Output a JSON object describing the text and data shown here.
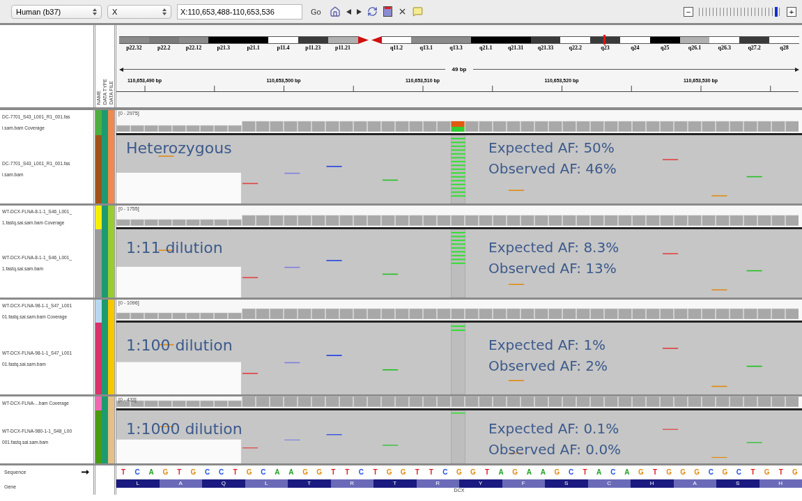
{
  "toolbar": {
    "genome": "Human (b37)",
    "chromosome": "X",
    "locus": "X:110,653,488-110,653,536",
    "go": "Go",
    "zoom": {
      "minus": "−",
      "plus": "+",
      "level": 0.96
    }
  },
  "attribute_headers": [
    "NAME",
    "DATA TYPE",
    "DATA FILE"
  ],
  "ideogram": {
    "bands": [
      {
        "label": "p22.32",
        "color": "#8a8a8a",
        "selected": false
      },
      {
        "label": "p22.2",
        "color": "#7a7a7a",
        "selected": false
      },
      {
        "label": "p22.12",
        "color": "#8a8a8a",
        "selected": false
      },
      {
        "label": "p21.3",
        "color": "#000000",
        "selected": false
      },
      {
        "label": "p21.1",
        "color": "#000000",
        "selected": false
      },
      {
        "label": "p11.4",
        "color": "#ffffff",
        "selected": false
      },
      {
        "label": "p11.23",
        "color": "#3a3a3a",
        "selected": false
      },
      {
        "label": "p11.21",
        "color": "#b0b0b0",
        "selected": false
      },
      {
        "label": "q11.2",
        "color": "#ffffff",
        "selected": false
      },
      {
        "label": "q13.1",
        "color": "#8a8a8a",
        "selected": false
      },
      {
        "label": "q13.3",
        "color": "#8a8a8a",
        "selected": false
      },
      {
        "label": "q21.1",
        "color": "#000000",
        "selected": false
      },
      {
        "label": "q21.31",
        "color": "#000000",
        "selected": false
      },
      {
        "label": "q21.33",
        "color": "#3a3a3a",
        "selected": false
      },
      {
        "label": "q22.2",
        "color": "#ffffff",
        "selected": false
      },
      {
        "label": "q23",
        "color": "#3a3a3a",
        "selected": true
      },
      {
        "label": "q24",
        "color": "#ffffff",
        "selected": false
      },
      {
        "label": "q25",
        "color": "#000000",
        "selected": false
      },
      {
        "label": "q26.1",
        "color": "#b0b0b0",
        "selected": false
      },
      {
        "label": "q26.3",
        "color": "#ffffff",
        "selected": false
      },
      {
        "label": "q27.2",
        "color": "#3a3a3a",
        "selected": false
      },
      {
        "label": "q28",
        "color": "#ffffff",
        "selected": false
      }
    ]
  },
  "ruler": {
    "span": "49 bp",
    "ticks": [
      "110,653,490 bp",
      "110,653,500 bp",
      "110,653,510 bp",
      "110,653,520 bp",
      "110,653,530 bp"
    ]
  },
  "tracks": [
    {
      "coverage_name": [
        "DC-7701_S43_L001_R1_001.fas",
        "i.sam.bam Coverage"
      ],
      "reads_name": [
        "DC-7701_S43_L001_R1_001.fas",
        "i.sam.bam"
      ],
      "range": "[0 - 2975]",
      "coverage_colors": [
        {
          "color": "#4caf3f"
        },
        {
          "color": "#1e9a70"
        },
        {
          "color": "#f08a50"
        }
      ],
      "reads_colors": [
        {
          "color": "#a0521a"
        },
        {
          "color": "#1e9a70"
        },
        {
          "color": "#f08a50"
        }
      ],
      "label": "Heterozygous",
      "expected": "Expected AF: 50%",
      "observed": "Observed AF: 46%"
    },
    {
      "coverage_name": [
        "WT-DCX-FLNA-8-1-1_S46_L001_",
        "1.fastq.sai.sam.bam Coverage"
      ],
      "reads_name": [
        "WT-DCX-FLNA-8-1-1_S46_L001_",
        "1.fastq.sai.sam.bam"
      ],
      "range": "[0 - 1755]",
      "coverage_colors": [
        {
          "color": "#f5f000"
        },
        {
          "color": "#1e9a70"
        },
        {
          "color": "#9acd32"
        }
      ],
      "reads_colors": [
        {
          "color": "#9a9a9a"
        },
        {
          "color": "#1e9a70"
        },
        {
          "color": "#9acd32"
        }
      ],
      "label": "1:11 dilution",
      "expected": "Expected AF: 8.3%",
      "observed": "Observed AF: 13%"
    },
    {
      "coverage_name": [
        "WT-DCX-FLNA-98-1-1_S47_L001",
        "01.fastq.sai.sam.bam Coverage"
      ],
      "reads_name": [
        "WT-DCX-FLNA-98-1-1_S47_L001",
        "01.fastq.sai.sam.bam"
      ],
      "range": "[0 - 1096]",
      "coverage_colors": [
        {
          "color": "#b8d8f0"
        },
        {
          "color": "#1e9a70"
        },
        {
          "color": "#f5c800"
        }
      ],
      "reads_colors": [
        {
          "color": "#d8336a"
        },
        {
          "color": "#1e9a70"
        },
        {
          "color": "#f5c800"
        }
      ],
      "label": "1:100 dilution",
      "expected": "Expected AF: 1%",
      "observed": "Observed AF: 2%"
    },
    {
      "coverage_name": [
        "WT-DCX-FLNA-...bam Coverage"
      ],
      "reads_name": [
        "WT-DCX-FLNA-980-1-1_S48_L00",
        "001.fastq.sai.sam.bam"
      ],
      "range": "[0 - 433]",
      "coverage_colors": [
        {
          "color": "#f06ab0"
        },
        {
          "color": "#1e9a70"
        },
        {
          "color": "#e4c088"
        }
      ],
      "reads_colors": [
        {
          "color": "#4a9a10"
        },
        {
          "color": "#1e9a70"
        },
        {
          "color": "#e4c088"
        }
      ],
      "label": "1:1000 dilution",
      "expected": "Expected AF: 0.1%",
      "observed": "Observed AF: 0.0%"
    }
  ],
  "sequence": {
    "name": "Sequence",
    "bases": [
      {
        "b": "T",
        "color": "#e02020"
      },
      {
        "b": "C",
        "color": "#2050e0"
      },
      {
        "b": "A",
        "color": "#20a020"
      },
      {
        "b": "G",
        "color": "#e08a10"
      },
      {
        "b": "T",
        "color": "#e02020"
      },
      {
        "b": "G",
        "color": "#e08a10"
      },
      {
        "b": "C",
        "color": "#2050e0"
      },
      {
        "b": "C",
        "color": "#2050e0"
      },
      {
        "b": "T",
        "color": "#e02020"
      },
      {
        "b": "G",
        "color": "#e08a10"
      },
      {
        "b": "C",
        "color": "#2050e0"
      },
      {
        "b": "A",
        "color": "#20a020"
      },
      {
        "b": "A",
        "color": "#20a020"
      },
      {
        "b": "G",
        "color": "#e08a10"
      },
      {
        "b": "G",
        "color": "#e08a10"
      },
      {
        "b": "T",
        "color": "#e02020"
      },
      {
        "b": "T",
        "color": "#e02020"
      },
      {
        "b": "C",
        "color": "#2050e0"
      },
      {
        "b": "T",
        "color": "#e02020"
      },
      {
        "b": "G",
        "color": "#e08a10"
      },
      {
        "b": "G",
        "color": "#e08a10"
      },
      {
        "b": "T",
        "color": "#e02020"
      },
      {
        "b": "T",
        "color": "#e02020"
      },
      {
        "b": "C",
        "color": "#2050e0"
      },
      {
        "b": "G",
        "color": "#e08a10"
      },
      {
        "b": "G",
        "color": "#e08a10"
      },
      {
        "b": "T",
        "color": "#e02020"
      },
      {
        "b": "A",
        "color": "#20a020"
      },
      {
        "b": "G",
        "color": "#e08a10"
      },
      {
        "b": "A",
        "color": "#20a020"
      },
      {
        "b": "A",
        "color": "#20a020"
      },
      {
        "b": "G",
        "color": "#e08a10"
      },
      {
        "b": "C",
        "color": "#2050e0"
      },
      {
        "b": "T",
        "color": "#e02020"
      },
      {
        "b": "A",
        "color": "#20a020"
      },
      {
        "b": "C",
        "color": "#2050e0"
      },
      {
        "b": "A",
        "color": "#20a020"
      },
      {
        "b": "G",
        "color": "#e08a10"
      },
      {
        "b": "T",
        "color": "#e02020"
      },
      {
        "b": "G",
        "color": "#e08a10"
      },
      {
        "b": "G",
        "color": "#e08a10"
      },
      {
        "b": "G",
        "color": "#e08a10"
      },
      {
        "b": "C",
        "color": "#2050e0"
      },
      {
        "b": "G",
        "color": "#e08a10"
      },
      {
        "b": "C",
        "color": "#2050e0"
      },
      {
        "b": "T",
        "color": "#e02020"
      },
      {
        "b": "G",
        "color": "#e08a10"
      },
      {
        "b": "T",
        "color": "#e02020"
      },
      {
        "b": "G",
        "color": "#e08a10"
      }
    ]
  },
  "gene": {
    "name": "Gene",
    "symbol": "DCX",
    "amino_acids": [
      "L",
      "A",
      "Q",
      "L",
      "T",
      "R",
      "T",
      "R",
      "Y",
      "F",
      "S",
      "C",
      "H",
      "A",
      "S",
      "H"
    ]
  }
}
